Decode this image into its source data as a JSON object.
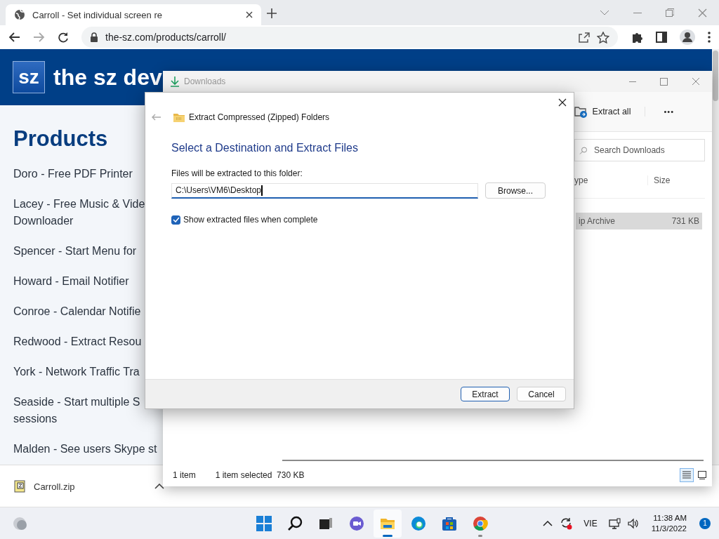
{
  "browser": {
    "tab": {
      "title": "Carroll - Set individual screen re"
    },
    "address": "the-sz.com/products/carroll/"
  },
  "page": {
    "logo": "sz",
    "site_title": "the sz dev",
    "heading": "Products",
    "products": [
      {
        "lines": [
          "Doro - Free PDF Printer"
        ]
      },
      {
        "lines": [
          "Lacey - Free Music & Vide",
          "Downloader"
        ]
      },
      {
        "lines": [
          "Spencer - Start Menu for"
        ]
      },
      {
        "lines": [
          "Howard - Email Notifier"
        ]
      },
      {
        "lines": [
          "Conroe - Calendar Notifie"
        ]
      },
      {
        "lines": [
          "Redwood - Extract Resou"
        ]
      },
      {
        "lines": [
          "York - Network Traffic Tra"
        ]
      },
      {
        "lines": [
          "Seaside - Start multiple S",
          "sessions"
        ]
      },
      {
        "lines": [
          "Malden - See users Skype st"
        ]
      }
    ]
  },
  "download_shelf": {
    "file": "Carroll.zip"
  },
  "explorer": {
    "title": "Downloads",
    "toolbar_action": "Extract all",
    "more": "•••",
    "search": {
      "placeholder": "Search Downloads"
    },
    "columns": [
      "ype",
      "Size"
    ],
    "rows": [
      {
        "cells": [
          "ip Archive",
          "731 KB"
        ],
        "selected": true
      }
    ],
    "status": [
      "1 item",
      "1 item selected  730 KB"
    ],
    "views": [
      {
        "kind": "details",
        "selected": true
      },
      {
        "kind": "tiles",
        "selected": false
      }
    ]
  },
  "dialog": {
    "title": "Extract Compressed (Zipped) Folders",
    "heading": "Select a Destination and Extract Files",
    "field_label": "Files will be extracted to this folder:",
    "path": "C:\\Users\\VM6\\Desktop",
    "browse": "Browse...",
    "checkbox": {
      "label": "Show extracted files when complete",
      "checked": true
    },
    "buttons": [
      {
        "label": "Extract",
        "default": true
      },
      {
        "label": "Cancel",
        "default": false
      }
    ]
  },
  "taskbar": {
    "apps": [
      {
        "kind": "start",
        "running": false,
        "active": false
      },
      {
        "kind": "search",
        "running": false,
        "active": false
      },
      {
        "kind": "taskview",
        "running": false,
        "active": false
      },
      {
        "kind": "chat",
        "running": false,
        "active": false
      },
      {
        "kind": "explorer",
        "running": true,
        "active": true
      },
      {
        "kind": "edge",
        "running": false,
        "active": false
      },
      {
        "kind": "store",
        "running": false,
        "active": false
      },
      {
        "kind": "chrome",
        "running": true,
        "active": false
      }
    ],
    "language": "VIE",
    "time": "11:38 AM",
    "date": "11/3/2022",
    "notifications": "1"
  }
}
